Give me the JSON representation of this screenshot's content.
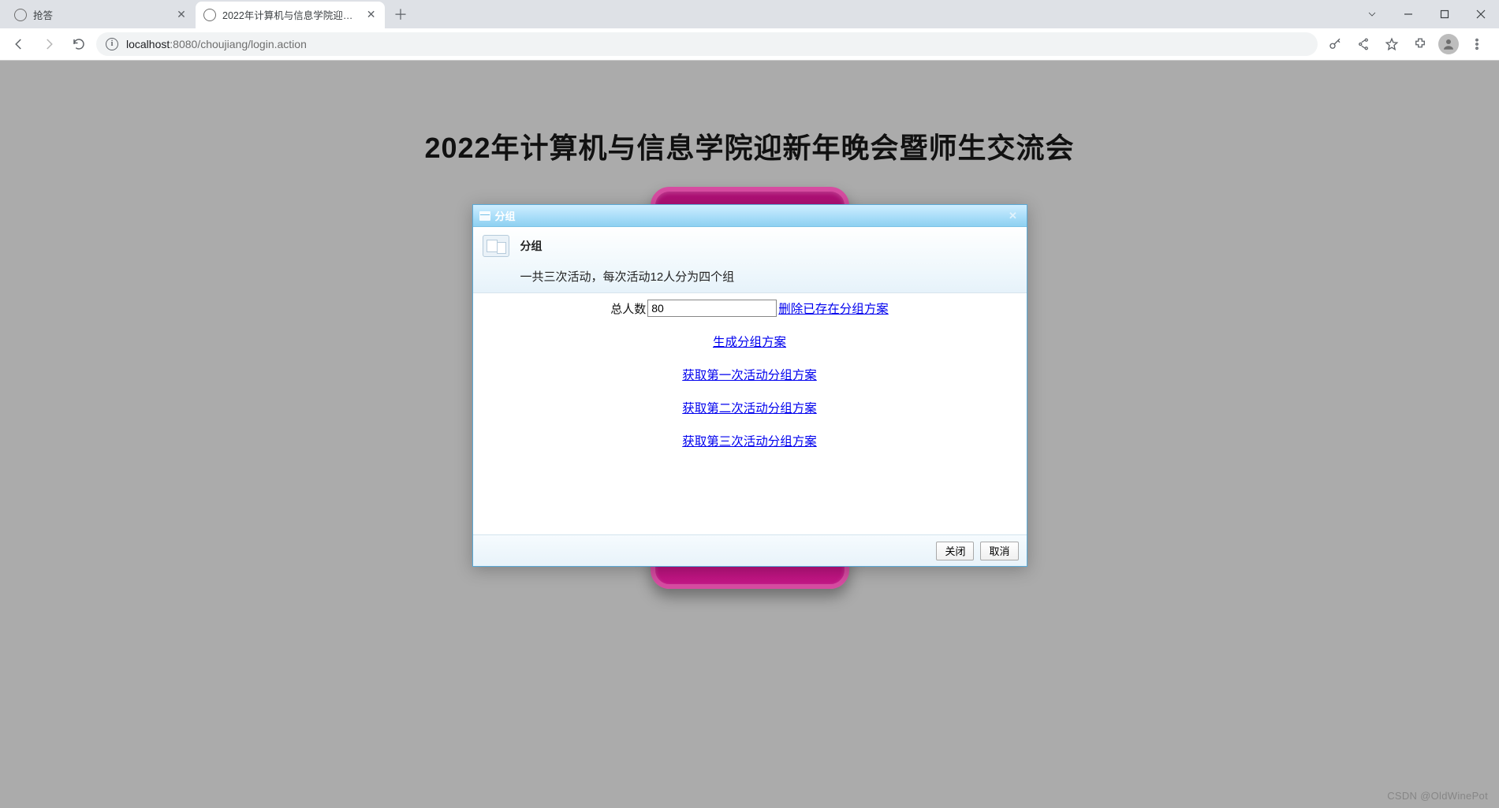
{
  "browser": {
    "tabs": [
      {
        "title": "抢答",
        "active": false
      },
      {
        "title": "2022年计算机与信息学院迎新年...",
        "active": true
      }
    ],
    "url_host": "localhost",
    "url_port": ":8080",
    "url_path": "/choujiang/login.action"
  },
  "page": {
    "title": "2022年计算机与信息学院迎新年晚会暨师生交流会"
  },
  "modal": {
    "window_title": "分组",
    "header_title": "分组",
    "header_desc": "一共三次活动，每次活动12人分为四个组",
    "total_label": "总人数",
    "total_value": "80",
    "delete_link": "删除已存在分组方案",
    "links": [
      "生成分组方案",
      "获取第一次活动分组方案",
      "获取第二次活动分组方案",
      "获取第三次活动分组方案"
    ],
    "close_btn": "关闭",
    "cancel_btn": "取消"
  },
  "watermark": "CSDN @OldWinePot"
}
